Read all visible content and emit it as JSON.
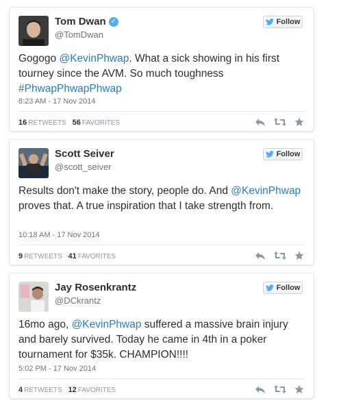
{
  "tweets": [
    {
      "name": "Tom Dwan",
      "handle": "@TomDwan",
      "verified": true,
      "follow_label": "Follow",
      "text_parts": [
        "Gogogo ",
        "@KevinPhwap",
        ". What a sick showing in his first tourney since the AVM. So much toughness ",
        "#PhwapPhwapPhwap"
      ],
      "timestamp": "8:23 AM - 17 Nov 2014",
      "retweets": "16",
      "retweets_label": "RETWEETS",
      "favorites": "56",
      "favorites_label": "FAVORITES"
    },
    {
      "name": "Scott Seiver",
      "handle": "@scott_seiver",
      "verified": false,
      "follow_label": "Follow",
      "text_parts": [
        "Results don't make the story, people do. And ",
        "@KevinPhwap",
        " proves that. A true inspiration that I take strength from."
      ],
      "timestamp": "10:18 AM - 17 Nov 2014",
      "retweets": "9",
      "retweets_label": "RETWEETS",
      "favorites": "41",
      "favorites_label": "FAVORITES"
    },
    {
      "name": "Jay Rosenkrantz",
      "handle": "@DCkrantz",
      "verified": false,
      "follow_label": "Follow",
      "text_parts": [
        "16mo ago, ",
        "@KevinPhwap",
        " suffered a massive brain injury and barely survived. Today he came in 4th in a poker tournament for $35k. CHAMPION!!!!"
      ],
      "timestamp": "5:02 PM - 17 Nov 2014",
      "retweets": "4",
      "retweets_label": "RETWEETS",
      "favorites": "12",
      "favorites_label": "FAVORITES"
    }
  ],
  "icons": {
    "follow": "twitter-bird-icon",
    "verified": "verified-badge-icon",
    "reply": "reply-icon",
    "retweet": "retweet-icon",
    "favorite": "star-icon"
  },
  "colors": {
    "link": "#2b7bb9",
    "verified": "#55acee",
    "twitter_blue": "#55acee"
  }
}
